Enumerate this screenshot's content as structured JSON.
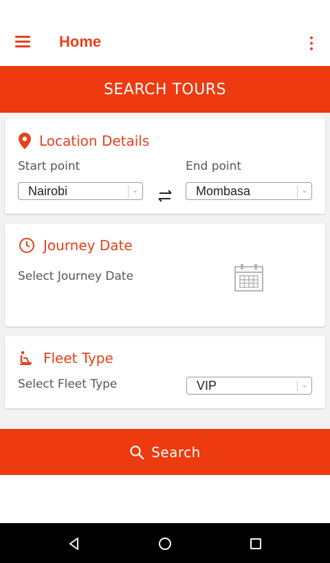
{
  "appbar": {
    "title": "Home",
    "menu_icon": "hamburger-menu-icon",
    "overflow_icon": "more-vert-icon"
  },
  "banner": {
    "title": "SEARCH TOURS"
  },
  "location": {
    "heading": "Location Details",
    "icon": "location-pin-icon",
    "start_label": "Start point",
    "end_label": "End point",
    "start_value": "Nairobi",
    "end_value": "Mombasa",
    "swap_icon": "swap-arrows-icon"
  },
  "journey": {
    "heading": "Journey Date",
    "icon": "clock-icon",
    "prompt": "Select Journey Date",
    "calendar_icon": "calendar-icon"
  },
  "fleet": {
    "heading": "Fleet Type",
    "icon": "seat-icon",
    "prompt": "Select Fleet Type",
    "value": "VIP"
  },
  "search_button": {
    "label": "Search",
    "icon": "search-icon"
  },
  "navbar": {
    "back_icon": "back-icon",
    "home_icon": "home-icon",
    "recents_icon": "recents-icon"
  },
  "colors": {
    "accent": "#ee3a0f",
    "text_accent": "#e8401b",
    "background": "#f2f2f2"
  }
}
